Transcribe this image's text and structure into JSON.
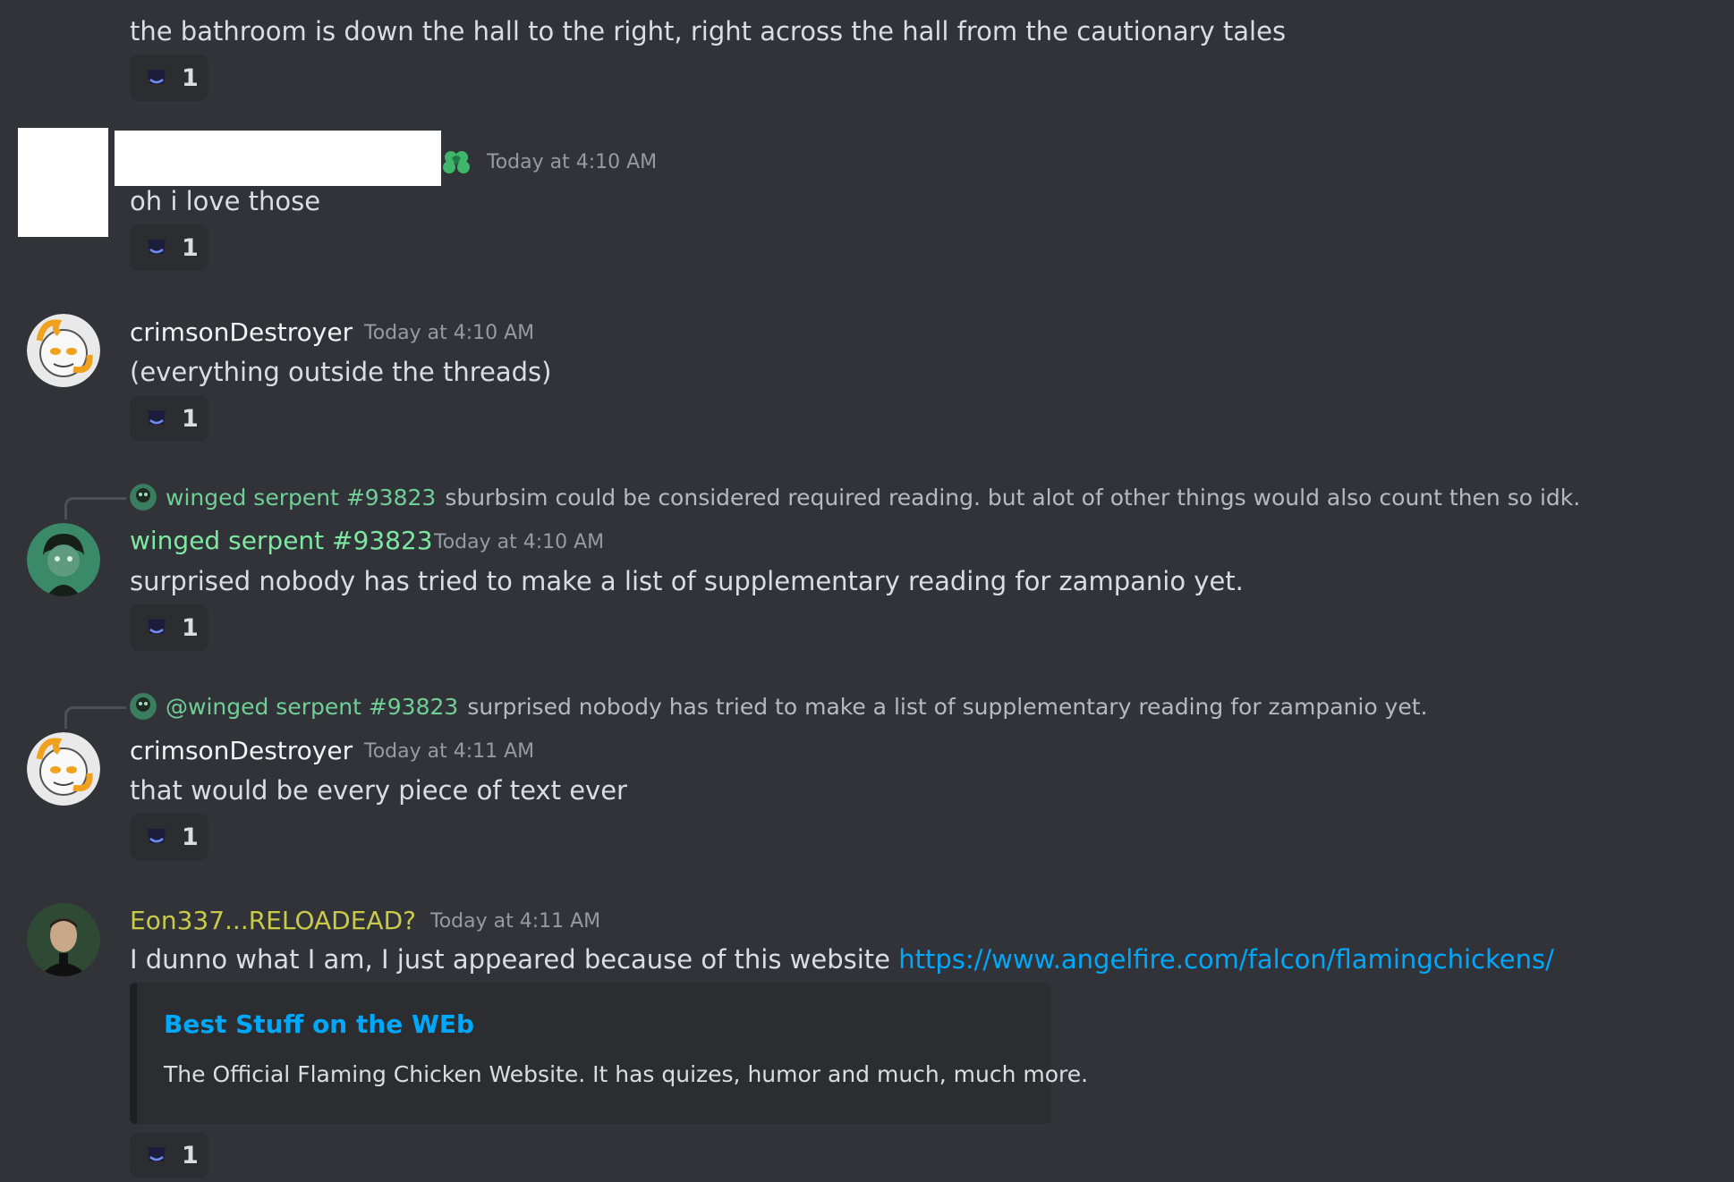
{
  "messages": [
    {
      "text": "the bathroom is down the hall to the right, right across the hall from the cautionary tales",
      "reaction_count": "1"
    },
    {
      "username": "",
      "timestamp": "Today at 4:10 AM",
      "text": "oh i love those",
      "reaction_count": "1",
      "badge_icon": "clover-heart-icon"
    },
    {
      "username": "crimsonDestroyer",
      "timestamp": "Today at 4:10 AM",
      "text": "(everything outside the threads)",
      "reaction_count": "1"
    },
    {
      "reply": {
        "name": "winged serpent #93823",
        "text": "sburbsim could be considered required reading. but alot of other things would also count then so idk."
      },
      "username": "winged serpent #93823",
      "timestamp": "Today at 4:10 AM",
      "text": "surprised nobody has tried to make a list of supplementary reading for zampanio yet.",
      "reaction_count": "1"
    },
    {
      "reply": {
        "name": "@winged serpent #93823",
        "text": "surprised nobody has tried to make a list of supplementary reading for zampanio yet."
      },
      "username": "crimsonDestroyer",
      "timestamp": "Today at 4:11 AM",
      "text": "that would be every piece of text ever",
      "reaction_count": "1"
    },
    {
      "username": "Eon337...RELOADEAD?",
      "timestamp": "Today at 4:11 AM",
      "text": "I dunno what I am, I just appeared because of this website ",
      "link": "https://www.angelfire.com/falcon/flamingchickens/",
      "embed": {
        "title": "Best Stuff on the WEb",
        "description": "The Official Flaming Chicken Website. It has quizes, humor and much, much more."
      },
      "reaction_count": "1"
    }
  ],
  "colors": {
    "background": "#313338",
    "username_default": "#f2f3f5",
    "username_winged_serpent": "#7ee8a2",
    "username_eon": "#c9c94a",
    "link": "#00a8fc",
    "timestamp": "#949ba4"
  }
}
